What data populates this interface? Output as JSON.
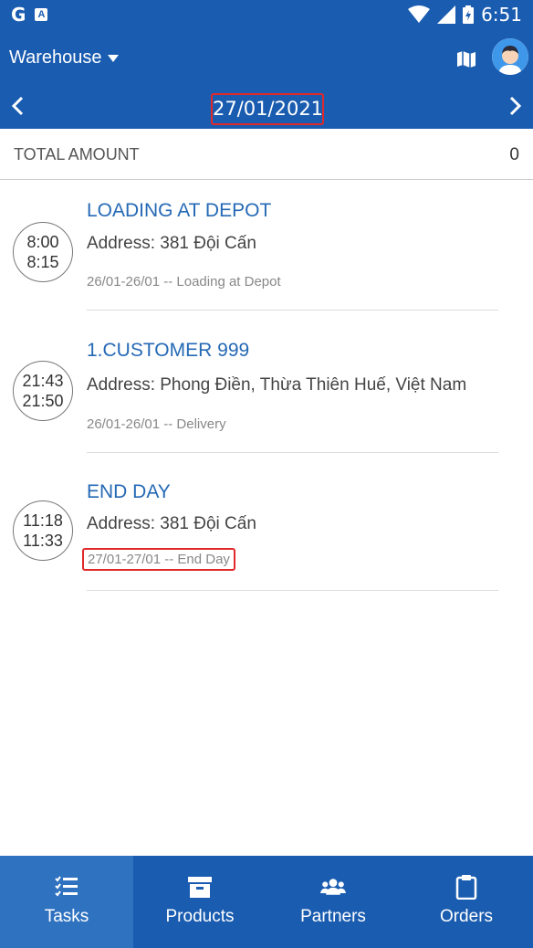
{
  "status_bar": {
    "time": "6:51",
    "left_icons": [
      "g-icon",
      "a-icon"
    ],
    "right_icons": [
      "wifi-icon",
      "signal-icon",
      "battery-icon"
    ]
  },
  "app_bar": {
    "title": "Warehouse",
    "date": "27/01/2021"
  },
  "summary": {
    "label": "TOTAL AMOUNT",
    "value": "0"
  },
  "tasks": [
    {
      "time_start": "8:00",
      "time_end": "8:15",
      "title": "LOADING AT DEPOT",
      "address": "Address: 381 Đội Cấn",
      "note": "26/01-26/01 -- Loading at Depot"
    },
    {
      "time_start": "21:43",
      "time_end": "21:50",
      "title": "1.CUSTOMER 999",
      "address": "Address: Phong Điền, Thừa Thiên Huế, Việt Nam",
      "note": "26/01-26/01 -- Delivery"
    },
    {
      "time_start": "11:18",
      "time_end": "11:33",
      "title": "END DAY",
      "address": "Address: 381 Đội Cấn",
      "note": "27/01-27/01 -- End Day"
    }
  ],
  "bottom_nav": [
    {
      "label": "Tasks",
      "icon": "checklist-icon",
      "active": true
    },
    {
      "label": "Products",
      "icon": "archive-box-icon",
      "active": false
    },
    {
      "label": "Partners",
      "icon": "users-icon",
      "active": false
    },
    {
      "label": "Orders",
      "icon": "clipboard-icon",
      "active": false
    }
  ],
  "colors": {
    "primary": "#1a5cb0",
    "active_tab": "#2f72c0",
    "title_text": "#2569b5",
    "highlight_box": "#e0292b"
  }
}
